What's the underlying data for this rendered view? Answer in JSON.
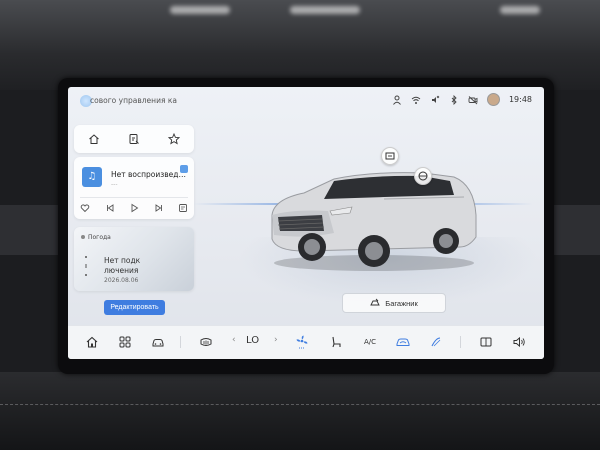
{
  "status_bar": {
    "app_title": "сового управления ка",
    "time": "19:48",
    "icons": [
      "user-icon",
      "wifi-icon",
      "mute-icon",
      "bluetooth-icon",
      "camera-off-icon",
      "avatar"
    ]
  },
  "nav_card": {
    "icons": [
      "home-icon",
      "route-icon",
      "star-icon"
    ]
  },
  "music": {
    "art_glyph": "♫",
    "title": "Нет воспроизвед…",
    "subtitle": "---",
    "controls": [
      "heart-icon",
      "prev-icon",
      "play-icon",
      "next-icon",
      "playlist-icon"
    ]
  },
  "weather": {
    "label": "Погода",
    "text_line1": "Нет подк",
    "text_line2": "лючения",
    "date": "2026.08.06"
  },
  "edit_button": "Редактировать",
  "car": {
    "hotspots": [
      "screen-icon",
      "lock-icon"
    ]
  },
  "trunk_button": "Багажник",
  "dock": {
    "temperature": "LO",
    "ac_label": "A/C",
    "accent_color": "#3f7de0"
  }
}
